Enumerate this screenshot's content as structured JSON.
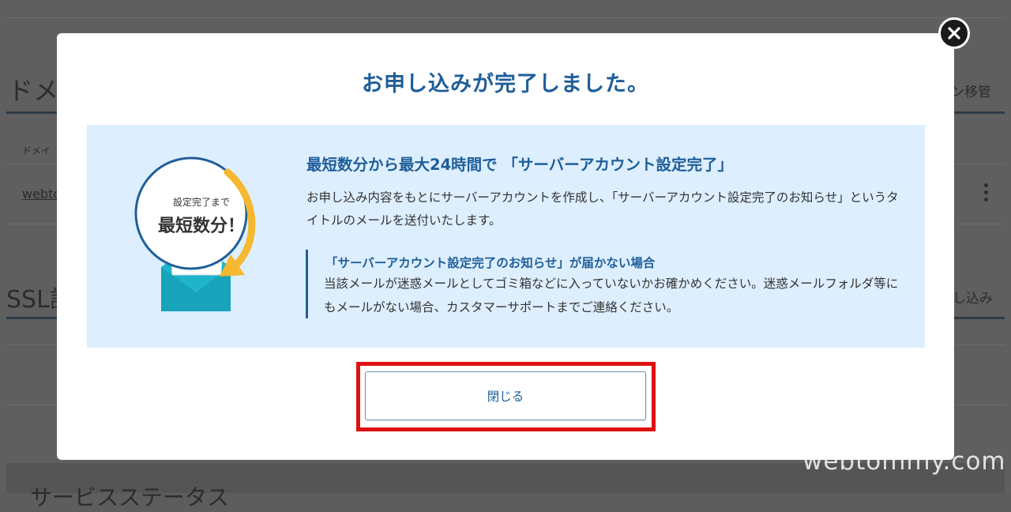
{
  "background": {
    "domain_section": "ドメ",
    "domain_column": "ドメイ",
    "domain_row": "webto",
    "domain_transfer": "ン移管",
    "ssl_section": "SSL設",
    "ssl_apply": "し込み",
    "footer_section": "サービスステータス"
  },
  "modal": {
    "title": "お申し込みが完了しました。",
    "illustration": {
      "badge_line1": "設定完了まで",
      "badge_line2": "最短数分！"
    },
    "heading": "最短数分から最大24時間で 「サーバーアカウント設定完了」",
    "body": "お申し込み内容をもとにサーバーアカウントを作成し、「サーバーアカウント設定完了のお知らせ」というタイトルのメールを送付いたします。",
    "notice_title": "「サーバーアカウント設定完了のお知らせ」が届かない場合",
    "notice_body": "当該メールが迷惑メールとしてゴミ箱などに入っていないかお確かめください。迷惑メールフォルダ等にもメールがない場合、カスタマーサポートまでご連絡ください。",
    "close_button_label": "閉じる"
  },
  "watermark": "webtommy.com",
  "colors": {
    "accent": "#1f5e99",
    "panel": "#ddeeff",
    "highlight": "#dd1111",
    "envelope": "#1eb5cc",
    "arrow": "#f5b82e"
  }
}
